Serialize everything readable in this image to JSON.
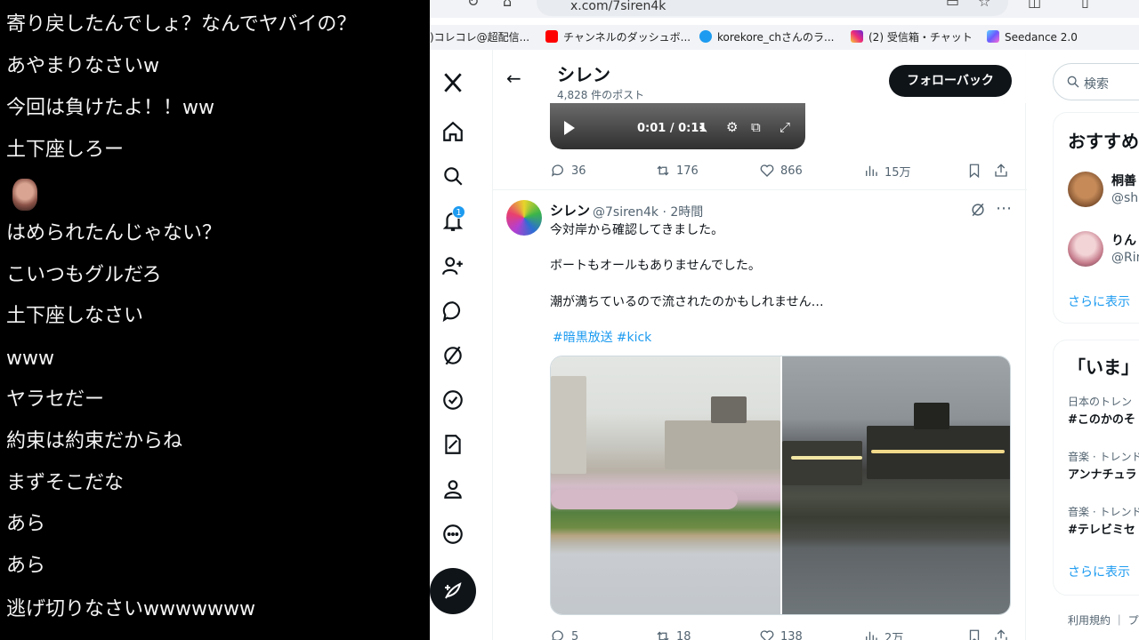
{
  "chat": {
    "lines": [
      "寄り戻したんでしょ？なんでヤバイの？",
      "あやまりなさいw",
      "今回は負けたよ！！ww",
      "土下座しろー",
      "はめられたんじゃない？",
      "こいつもグルだろ",
      "土下座しなさい",
      "www",
      "ヤラセだー",
      "約束は約束だからね",
      "まずそこだな",
      "あら",
      "あら",
      "逃げ切りなさいwwwwwww"
    ]
  },
  "browser": {
    "url": "x.com/7siren4k",
    "bookmarks": [
      {
        "label": ")コレコレ@超配信...",
        "color": "#f5c518"
      },
      {
        "label": "チャンネルのダッシュボ...",
        "color": "#ff0000"
      },
      {
        "label": "korekore_chさんのラ...",
        "color": "#1d9bf0"
      },
      {
        "label": "(2) 受信箱・チャット",
        "color": "#d6249f"
      },
      {
        "label": "Seedance 2.0",
        "color": "#6a5cff"
      }
    ]
  },
  "profile": {
    "name": "シレン",
    "post_count": "4,828 件のポスト",
    "follow_back_label": "フォローバック"
  },
  "video": {
    "time": "0:01 / 0:11"
  },
  "post1_actions": {
    "replies": "36",
    "reposts": "176",
    "likes": "866",
    "views": "15万"
  },
  "post2": {
    "name": "シレン",
    "handle_time": "@7siren4k · 2時間",
    "line1": "今対岸から確認してきました。",
    "line2": "ボートもオールもありませんでした。",
    "line3": "潮が満ちているので流されたのかもしれません…",
    "hashtag1": "#暗黒放送",
    "hashtag2": "#kick",
    "replies": "5",
    "reposts": "18",
    "likes": "138",
    "views": "2万"
  },
  "sidebar": {
    "search_placeholder": "検索",
    "recommend_title": "おすすめ",
    "user1_name": "桐善",
    "user1_handle": "@shi",
    "user2_name": "りん",
    "user2_handle": "@Rin",
    "show_more": "さらに表示",
    "trends_title": "「いま」",
    "trend1_meta": "日本のトレン",
    "trend1_tag": "#このかのそ",
    "trend2_meta": "音楽 · トレンド",
    "trend2_tag": "アンナチュラ",
    "trend3_meta": "音楽 · トレンド",
    "trend3_tag": "#テレビミセ",
    "footer": "利用規約 ｜ プ"
  },
  "nav": {
    "notification_count": "1"
  },
  "colors": {
    "accent": "#1d9bf0",
    "text": "#0f1419",
    "muted": "#536471"
  }
}
